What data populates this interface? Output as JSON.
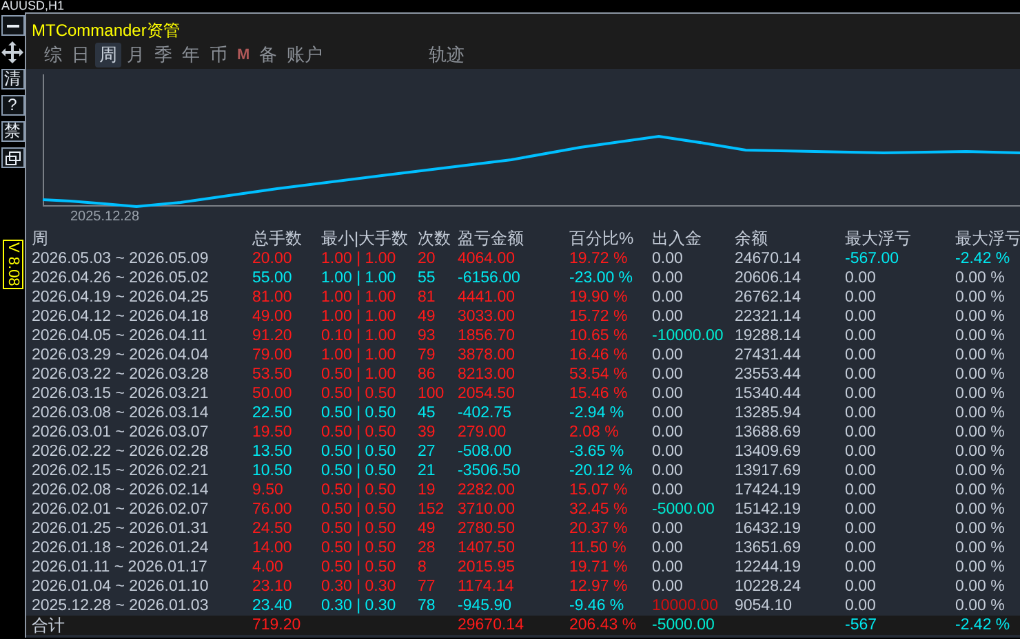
{
  "chart_symbol": "AUUSD,H1",
  "toolbar": {
    "buttons": [
      "清",
      "?",
      "禁"
    ],
    "version": "V 8.08"
  },
  "window": {
    "title": "MTCommander资管",
    "tabs": [
      {
        "label": "综",
        "selected": false,
        "disabled": false
      },
      {
        "label": "日",
        "selected": false,
        "disabled": false
      },
      {
        "label": "周",
        "selected": true,
        "disabled": false
      },
      {
        "label": "月",
        "selected": false,
        "disabled": false
      },
      {
        "label": "季",
        "selected": false,
        "disabled": false
      },
      {
        "label": "年",
        "selected": false,
        "disabled": false
      },
      {
        "label": "币",
        "selected": false,
        "disabled": false
      },
      {
        "label": "M",
        "selected": false,
        "disabled": true
      },
      {
        "label": "备",
        "selected": false,
        "disabled": false
      },
      {
        "label": "账户",
        "selected": false,
        "disabled": false
      }
    ],
    "extra_tabs": [
      {
        "label": "轨迹",
        "selected": false,
        "disabled": false
      }
    ],
    "chart": {
      "start_label": "2025.12.28"
    },
    "table": {
      "columns": [
        "周",
        "总手数",
        "最小|大手数",
        "次数",
        "盈亏金额",
        "百分比%",
        "出入金",
        "余额",
        "最大浮亏",
        "最大浮亏"
      ],
      "rows": [
        {
          "week": "2026.05.03 ~ 2026.05.09",
          "color": "#ff1a1a",
          "lots": "20.00",
          "min_max": "1.00 | 1.00",
          "trades": "20",
          "pnl": "4064.00",
          "pct": "19.72 %",
          "deposit": {
            "text": "0.00",
            "color": "#c4ccd8"
          },
          "balance": "24670.14",
          "drawdown": {
            "amount": "-567.00",
            "percent": "-2.42 %",
            "color": "#00e8f0"
          }
        },
        {
          "week": "2026.04.26 ~ 2026.05.02",
          "color": "#00e8f0",
          "lots": "55.00",
          "min_max": "1.00 | 1.00",
          "trades": "55",
          "pnl": "-6156.00",
          "pct": "-23.00 %",
          "deposit": {
            "text": "0.00",
            "color": "#c4ccd8"
          },
          "balance": "20606.14",
          "drawdown": {
            "amount": "0.00",
            "percent": "0.00 %",
            "color": "#c4ccd8"
          }
        },
        {
          "week": "2026.04.19 ~ 2026.04.25",
          "color": "#ff1a1a",
          "lots": "81.00",
          "min_max": "1.00 | 1.00",
          "trades": "81",
          "pnl": "4441.00",
          "pct": "19.90 %",
          "deposit": {
            "text": "0.00",
            "color": "#c4ccd8"
          },
          "balance": "26762.14",
          "drawdown": {
            "amount": "0.00",
            "percent": "0.00 %",
            "color": "#c4ccd8"
          }
        },
        {
          "week": "2026.04.12 ~ 2026.04.18",
          "color": "#ff1a1a",
          "lots": "49.00",
          "min_max": "1.00 | 1.00",
          "trades": "49",
          "pnl": "3033.00",
          "pct": "15.72 %",
          "deposit": {
            "text": "0.00",
            "color": "#c4ccd8"
          },
          "balance": "22321.14",
          "drawdown": {
            "amount": "0.00",
            "percent": "0.00 %",
            "color": "#c4ccd8"
          }
        },
        {
          "week": "2026.04.05 ~ 2026.04.11",
          "color": "#ff1a1a",
          "lots": "91.20",
          "min_max": "0.10 | 1.00",
          "trades": "93",
          "pnl": "1856.70",
          "pct": "10.65 %",
          "deposit": {
            "text": "-10000.00",
            "color": "#00e8d0"
          },
          "balance": "19288.14",
          "drawdown": {
            "amount": "0.00",
            "percent": "0.00 %",
            "color": "#c4ccd8"
          }
        },
        {
          "week": "2026.03.29 ~ 2026.04.04",
          "color": "#ff1a1a",
          "lots": "79.00",
          "min_max": "1.00 | 1.00",
          "trades": "79",
          "pnl": "3878.00",
          "pct": "16.46 %",
          "deposit": {
            "text": "0.00",
            "color": "#c4ccd8"
          },
          "balance": "27431.44",
          "drawdown": {
            "amount": "0.00",
            "percent": "0.00 %",
            "color": "#c4ccd8"
          }
        },
        {
          "week": "2026.03.22 ~ 2026.03.28",
          "color": "#ff1a1a",
          "lots": "53.50",
          "min_max": "0.50 | 1.00",
          "trades": "86",
          "pnl": "8213.00",
          "pct": "53.54 %",
          "deposit": {
            "text": "0.00",
            "color": "#c4ccd8"
          },
          "balance": "23553.44",
          "drawdown": {
            "amount": "0.00",
            "percent": "0.00 %",
            "color": "#c4ccd8"
          }
        },
        {
          "week": "2026.03.15 ~ 2026.03.21",
          "color": "#ff1a1a",
          "lots": "50.00",
          "min_max": "0.50 | 0.50",
          "trades": "100",
          "pnl": "2054.50",
          "pct": "15.46 %",
          "deposit": {
            "text": "0.00",
            "color": "#c4ccd8"
          },
          "balance": "15340.44",
          "drawdown": {
            "amount": "0.00",
            "percent": "0.00 %",
            "color": "#c4ccd8"
          }
        },
        {
          "week": "2026.03.08 ~ 2026.03.14",
          "color": "#00e8f0",
          "lots": "22.50",
          "min_max": "0.50 | 0.50",
          "trades": "45",
          "pnl": "-402.75",
          "pct": "-2.94 %",
          "deposit": {
            "text": "0.00",
            "color": "#c4ccd8"
          },
          "balance": "13285.94",
          "drawdown": {
            "amount": "0.00",
            "percent": "0.00 %",
            "color": "#c4ccd8"
          }
        },
        {
          "week": "2026.03.01 ~ 2026.03.07",
          "color": "#ff1a1a",
          "lots": "19.50",
          "min_max": "0.50 | 0.50",
          "trades": "39",
          "pnl": "279.00",
          "pct": "2.08 %",
          "deposit": {
            "text": "0.00",
            "color": "#c4ccd8"
          },
          "balance": "13688.69",
          "drawdown": {
            "amount": "0.00",
            "percent": "0.00 %",
            "color": "#c4ccd8"
          }
        },
        {
          "week": "2026.02.22 ~ 2026.02.28",
          "color": "#00e8f0",
          "lots": "13.50",
          "min_max": "0.50 | 0.50",
          "trades": "27",
          "pnl": "-508.00",
          "pct": "-3.65 %",
          "deposit": {
            "text": "0.00",
            "color": "#c4ccd8"
          },
          "balance": "13409.69",
          "drawdown": {
            "amount": "0.00",
            "percent": "0.00 %",
            "color": "#c4ccd8"
          }
        },
        {
          "week": "2026.02.15 ~ 2026.02.21",
          "color": "#00e8f0",
          "lots": "10.50",
          "min_max": "0.50 | 0.50",
          "trades": "21",
          "pnl": "-3506.50",
          "pct": "-20.12 %",
          "deposit": {
            "text": "0.00",
            "color": "#c4ccd8"
          },
          "balance": "13917.69",
          "drawdown": {
            "amount": "0.00",
            "percent": "0.00 %",
            "color": "#c4ccd8"
          }
        },
        {
          "week": "2026.02.08 ~ 2026.02.14",
          "color": "#ff1a1a",
          "lots": "9.50",
          "min_max": "0.50 | 0.50",
          "trades": "19",
          "pnl": "2282.00",
          "pct": "15.07 %",
          "deposit": {
            "text": "0.00",
            "color": "#c4ccd8"
          },
          "balance": "17424.19",
          "drawdown": {
            "amount": "0.00",
            "percent": "0.00 %",
            "color": "#c4ccd8"
          }
        },
        {
          "week": "2026.02.01 ~ 2026.02.07",
          "color": "#ff1a1a",
          "lots": "76.00",
          "min_max": "0.50 | 0.50",
          "trades": "152",
          "pnl": "3710.00",
          "pct": "32.45 %",
          "deposit": {
            "text": "-5000.00",
            "color": "#00e8d0"
          },
          "balance": "15142.19",
          "drawdown": {
            "amount": "0.00",
            "percent": "0.00 %",
            "color": "#c4ccd8"
          }
        },
        {
          "week": "2026.01.25 ~ 2026.01.31",
          "color": "#ff1a1a",
          "lots": "24.50",
          "min_max": "0.50 | 0.50",
          "trades": "49",
          "pnl": "2780.50",
          "pct": "20.37 %",
          "deposit": {
            "text": "0.00",
            "color": "#c4ccd8"
          },
          "balance": "16432.19",
          "drawdown": {
            "amount": "0.00",
            "percent": "0.00 %",
            "color": "#c4ccd8"
          }
        },
        {
          "week": "2026.01.18 ~ 2026.01.24",
          "color": "#ff1a1a",
          "lots": "14.00",
          "min_max": "0.50 | 0.50",
          "trades": "28",
          "pnl": "1407.50",
          "pct": "11.50 %",
          "deposit": {
            "text": "0.00",
            "color": "#c4ccd8"
          },
          "balance": "13651.69",
          "drawdown": {
            "amount": "0.00",
            "percent": "0.00 %",
            "color": "#c4ccd8"
          }
        },
        {
          "week": "2026.01.11 ~ 2026.01.17",
          "color": "#ff1a1a",
          "lots": "4.00",
          "min_max": "0.50 | 0.50",
          "trades": "8",
          "pnl": "2015.95",
          "pct": "19.71 %",
          "deposit": {
            "text": "0.00",
            "color": "#c4ccd8"
          },
          "balance": "12244.19",
          "drawdown": {
            "amount": "0.00",
            "percent": "0.00 %",
            "color": "#c4ccd8"
          }
        },
        {
          "week": "2026.01.04 ~ 2026.01.10",
          "color": "#ff1a1a",
          "lots": "23.10",
          "min_max": "0.30 | 0.30",
          "trades": "77",
          "pnl": "1174.14",
          "pct": "12.97 %",
          "deposit": {
            "text": "0.00",
            "color": "#c4ccd8"
          },
          "balance": "10228.24",
          "drawdown": {
            "amount": "0.00",
            "percent": "0.00 %",
            "color": "#c4ccd8"
          }
        },
        {
          "week": "2025.12.28 ~ 2026.01.03",
          "color": "#00e8f0",
          "lots": "23.40",
          "min_max": "0.30 | 0.30",
          "trades": "78",
          "pnl": "-945.90",
          "pct": "-9.46 %",
          "deposit": {
            "text": "10000.00",
            "color": "#d01010"
          },
          "balance": "9054.10",
          "drawdown": {
            "amount": "0.00",
            "percent": "0.00 %",
            "color": "#c4ccd8"
          }
        }
      ],
      "totals": {
        "label": "合计",
        "color": "#ff1a1a",
        "lots": "719.20",
        "pnl": "29670.14",
        "pct": "206.43 %",
        "deposit": {
          "text": "-5000.00",
          "color": "#00e8d0"
        },
        "drawdown": {
          "amount": "-567",
          "percent": "-2.42 %",
          "color": "#00e8f0"
        }
      }
    }
  }
}
